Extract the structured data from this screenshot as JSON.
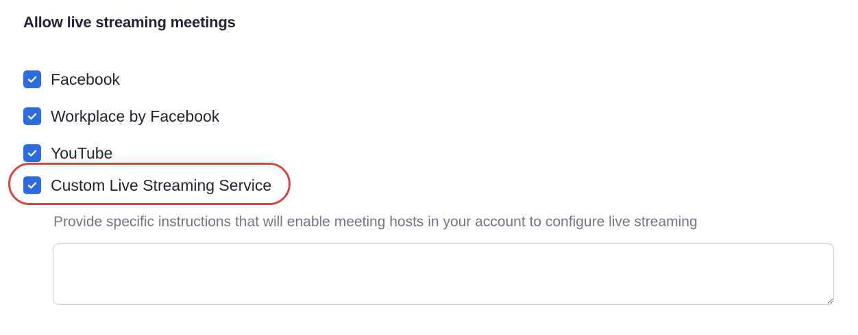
{
  "section": {
    "title": "Allow live streaming meetings"
  },
  "options": [
    {
      "label": "Facebook",
      "checked": true
    },
    {
      "label": "Workplace by Facebook",
      "checked": true
    },
    {
      "label": "YouTube",
      "checked": true
    },
    {
      "label": "Custom Live Streaming Service",
      "checked": true
    }
  ],
  "custom_service": {
    "instructions": "Provide specific instructions that will enable meeting hosts in your account to configure live streaming",
    "value": "",
    "placeholder": ""
  },
  "colors": {
    "checkbox_fill": "#2d6cdf",
    "highlight_ring": "#d9453a",
    "text": "#232333",
    "muted_text": "#747487"
  },
  "icons": {
    "checkbox": "check-icon"
  }
}
